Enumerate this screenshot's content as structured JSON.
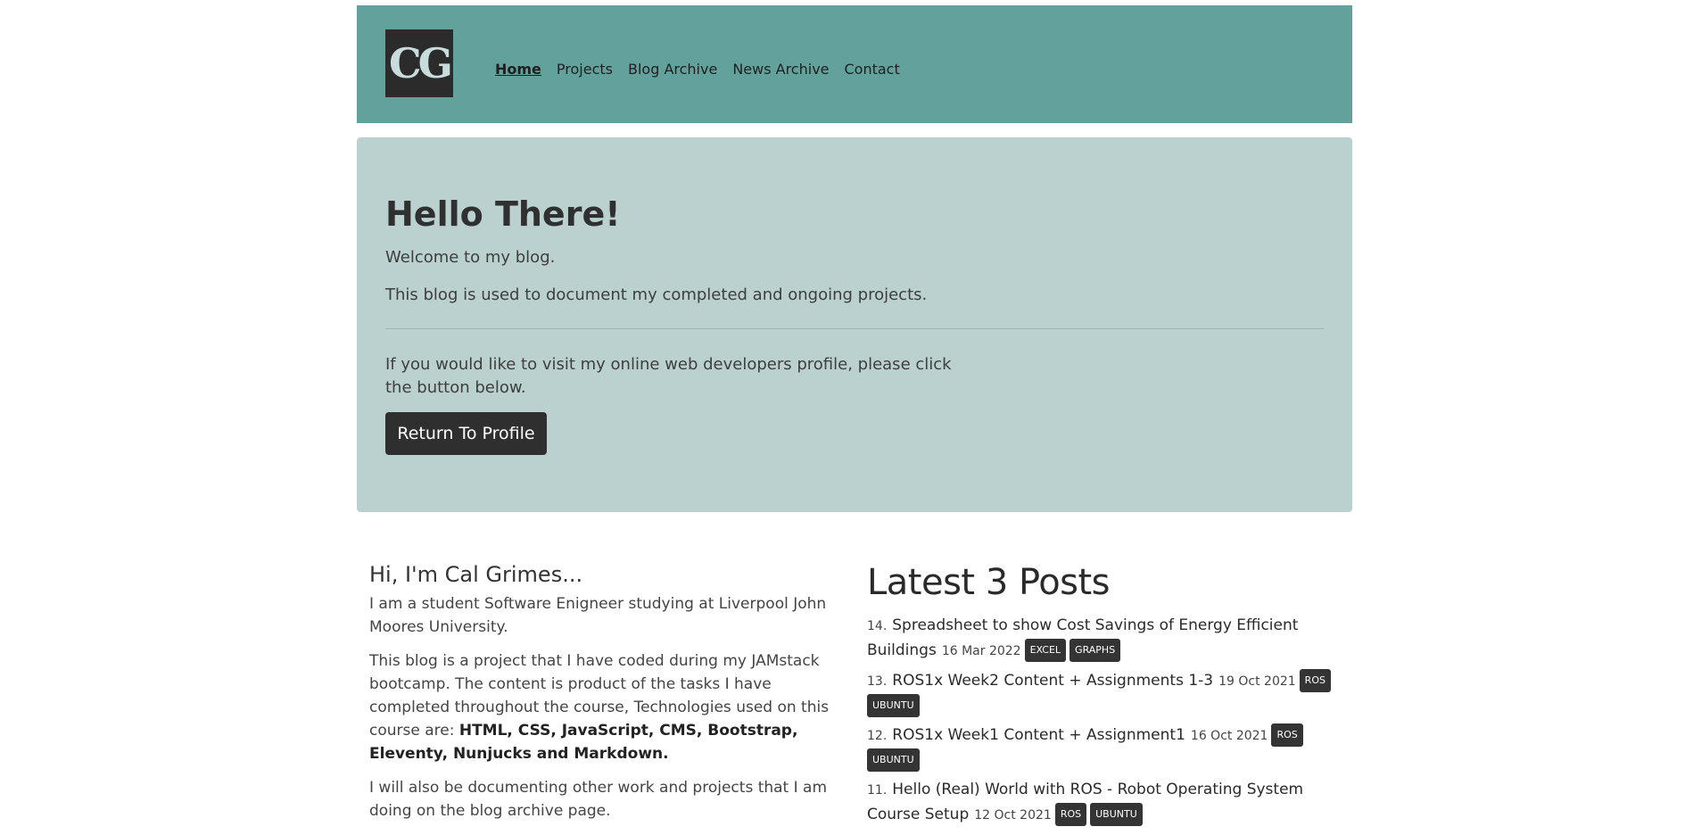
{
  "header": {
    "logo_text": "CG",
    "nav": [
      {
        "label": "Home",
        "active": true
      },
      {
        "label": "Projects",
        "active": false
      },
      {
        "label": "Blog Archive",
        "active": false
      },
      {
        "label": "News Archive",
        "active": false
      },
      {
        "label": "Contact",
        "active": false
      }
    ]
  },
  "hero": {
    "title": "Hello There!",
    "line1": "Welcome to my blog.",
    "line2": "This blog is used to document my completed and ongoing projects.",
    "line3": "If you would like to visit my online web developers profile, please click the button below.",
    "button": "Return To Profile"
  },
  "about": {
    "heading": "Hi, I'm Cal Grimes...",
    "p1": "I am a student Software Enigneer studying at Liverpool John Moores University.",
    "p2": "This blog is a project that I have coded during my JAMstack bootcamp. The content is product of the tasks I have completed throughout the course, Technologies used on this course are:",
    "p2_bold": "HTML, CSS, JavaScript, CMS, Bootstrap, Eleventy, Nunjucks and Markdown.",
    "p3": "I will also be documenting other work and projects that I am doing on the blog archive page."
  },
  "latest": {
    "heading": "Latest 3 Posts",
    "posts": [
      {
        "num": "14.",
        "title": "Spreadsheet to show Cost Savings of Energy Efficient Buildings",
        "date": "16 Mar 2022",
        "tags": [
          "EXCEL",
          "GRAPHS"
        ]
      },
      {
        "num": "13.",
        "title": "ROS1x Week2 Content + Assignments 1-3",
        "date": "19 Oct 2021",
        "tags": [
          "ROS",
          "UBUNTU"
        ]
      },
      {
        "num": "12.",
        "title": "ROS1x Week1 Content + Assignment1",
        "date": "16 Oct 2021",
        "tags": [
          "ROS",
          "UBUNTU"
        ]
      },
      {
        "num": "11.",
        "title": "Hello (Real) World with ROS - Robot Operating System Course Setup",
        "date": "12 Oct 2021",
        "tags": [
          "ROS",
          "UBUNTU"
        ]
      }
    ]
  },
  "colors": {
    "navbar": "#63a29c",
    "jumbotron": "#bbd1d0",
    "button": "#2f2f2f",
    "tag": "#343434"
  }
}
